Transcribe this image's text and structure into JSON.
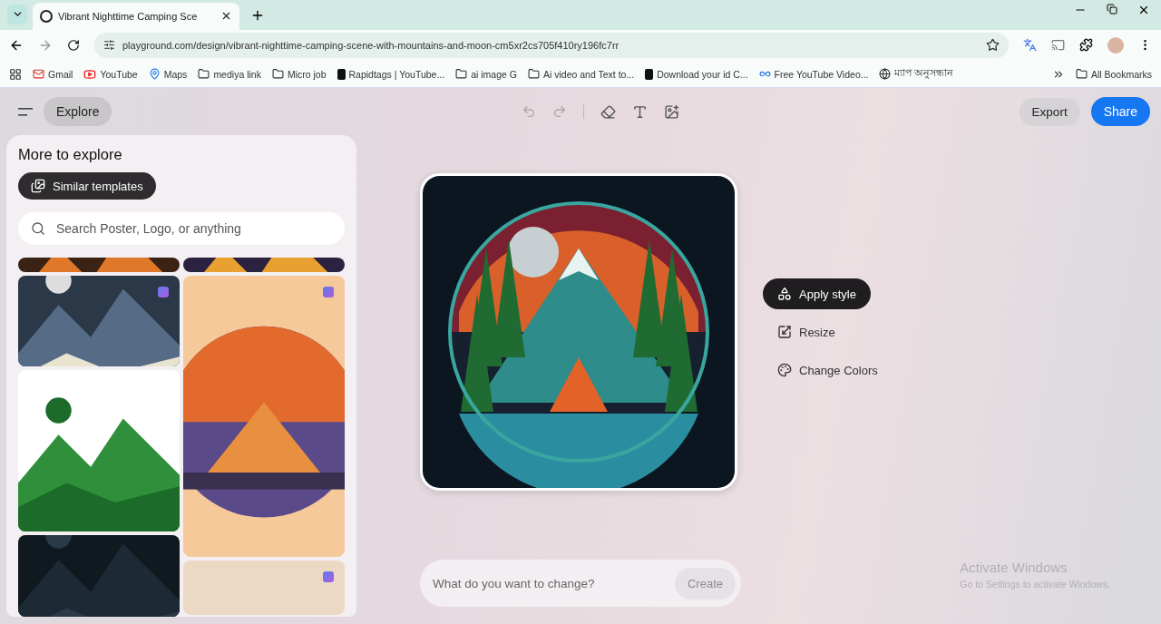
{
  "browser": {
    "tabs": [
      {
        "title": "Vibrant Nighttime Camping Sce",
        "selected": true
      }
    ],
    "url": "playground.com/design/vibrant-nighttime-camping-scene-with-mountains-and-moon-cm5xr2cs705f410ry196fc7rr",
    "bookmarks": [
      {
        "label": "Gmail",
        "kind": "gmail"
      },
      {
        "label": "YouTube",
        "kind": "youtube"
      },
      {
        "label": "Maps",
        "kind": "maps"
      },
      {
        "label": "mediya link",
        "kind": "folder"
      },
      {
        "label": "Micro job",
        "kind": "folder"
      },
      {
        "label": "Rapidtags | YouTube...",
        "kind": "letter"
      },
      {
        "label": "ai image G",
        "kind": "folder"
      },
      {
        "label": "Ai video and Text to...",
        "kind": "folder"
      },
      {
        "label": "Download your id C...",
        "kind": "letter"
      },
      {
        "label": "Free YouTube Video...",
        "kind": "loop"
      },
      {
        "label": "ম্যাপ অনুসন্ধান",
        "kind": "globe"
      }
    ],
    "all_bookmarks": "All Bookmarks"
  },
  "toolbar": {
    "explore": "Explore",
    "export": "Export",
    "share": "Share"
  },
  "panel": {
    "title": "More to explore",
    "chip": "Similar templates",
    "search": {
      "placeholder": "Search Poster, Logo, or anything"
    },
    "template_columns": [
      [
        {
          "kind": "fire",
          "badge": false
        },
        {
          "kind": "night",
          "badge": true
        },
        {
          "kind": "green",
          "badge": false
        },
        {
          "kind": "dark",
          "badge": false
        }
      ],
      [
        {
          "kind": "book",
          "badge": false
        },
        {
          "kind": "poster",
          "badge": true
        },
        {
          "kind": "stars",
          "badge": true
        }
      ]
    ]
  },
  "actions": [
    {
      "label": "Apply style",
      "kind": "style",
      "selected": true
    },
    {
      "label": "Resize",
      "kind": "resize",
      "selected": false
    },
    {
      "label": "Change Colors",
      "kind": "palette",
      "selected": false
    }
  ],
  "prompt": {
    "placeholder": "What do you want to change?",
    "button": "Create",
    "disabled": true
  },
  "os_notice": {
    "title": "Activate Windows",
    "text": "Go to Settings to activate Windows."
  }
}
